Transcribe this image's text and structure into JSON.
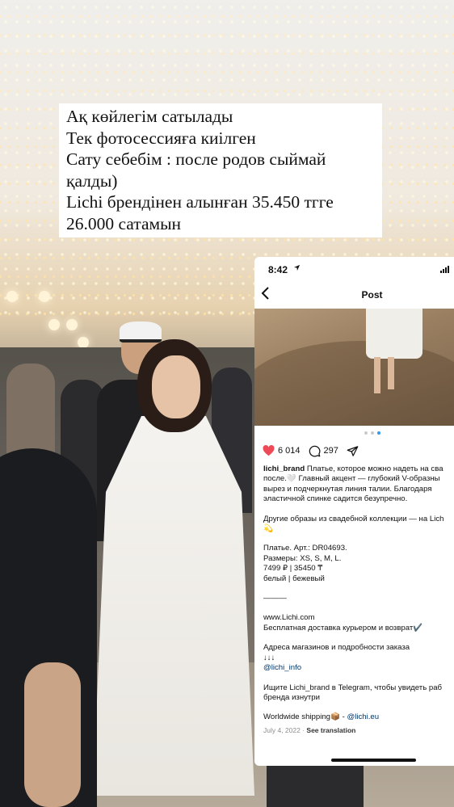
{
  "story": {
    "caption_lines": [
      "Ақ көйлегім сатылады",
      "Тек фотосессияға киілген",
      "Сату себебім : после родов сыймай",
      "қалды)",
      "Lichi брендінен алынған 35.450 тгге",
      "26.000 сатамын"
    ]
  },
  "phone": {
    "status": {
      "time": "8:42",
      "location_icon": "arrow-location-icon"
    },
    "nav": {
      "back_icon": "chevron-left-icon",
      "title": "Post"
    },
    "carousel": {
      "count": 3,
      "active_index": 2
    },
    "actions": {
      "likes": "6 014",
      "comments": "297"
    },
    "post": {
      "username": "lichi_brand",
      "lines": [
        "Платье, которое можно надеть на сва",
        "после.🤍 Главный акцент — глубокий V-образны",
        "вырез и подчеркнутая линия талии. Благодаря",
        "эластичной спинке садится безупречно."
      ],
      "collection_line1": "Другие образы из свадебной коллекции — на Lich",
      "collection_line2": "💫",
      "article": "Платье. Арт.: DR04693.",
      "sizes": "Размеры: XS, S, M, L.",
      "price": "7499 ₽ | 35450 ₸",
      "colors": "белый | бежевый",
      "divider": "———",
      "site": "www.Lichi.com",
      "delivery": "Бесплатная доставка курьером и возврат✔️",
      "stores": "Адреса магазинов и подробности заказа",
      "arrows": "↓↓↓",
      "info_handle": "@lichi_info",
      "telegram_line1": "Ищите Lichi_brand в Telegram, чтобы увидеть раб",
      "telegram_line2": "бренда изнутри",
      "shipping_text": "Worldwide shipping📦 - ",
      "shipping_handle": "@lichi.eu",
      "date": "July 4, 2022",
      "separator": " · ",
      "translation": "See translation"
    }
  },
  "colors": {
    "accent_blue": "#3797f0",
    "like_red": "#ed4956",
    "link": "#00376b"
  }
}
